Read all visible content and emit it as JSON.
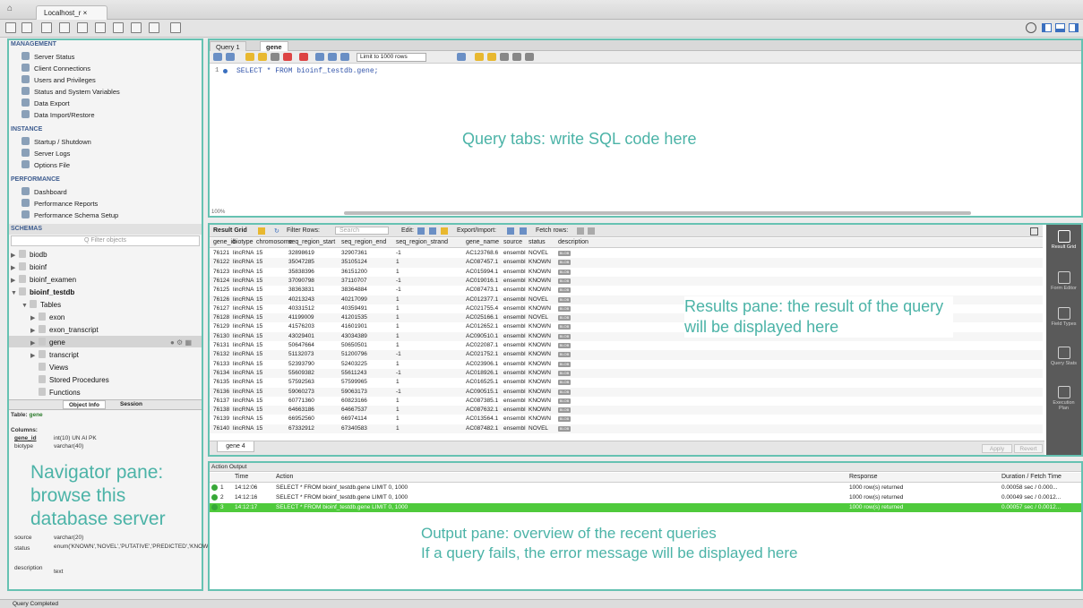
{
  "titlebar": {
    "connection_tab": "Localhost_r ×"
  },
  "navigator": {
    "management_title": "MANAGEMENT",
    "management": [
      "Server Status",
      "Client Connections",
      "Users and Privileges",
      "Status and System Variables",
      "Data Export",
      "Data Import/Restore"
    ],
    "instance_title": "INSTANCE",
    "instance": [
      "Startup / Shutdown",
      "Server Logs",
      "Options File"
    ],
    "performance_title": "PERFORMANCE",
    "performance": [
      "Dashboard",
      "Performance Reports",
      "Performance Schema Setup"
    ],
    "schemas_title": "SCHEMAS",
    "filter_placeholder": "Q Filter objects",
    "schemas": [
      "biodb",
      "bioinf",
      "bioinf_examen",
      "bioinf_testdb"
    ],
    "tables_label": "Tables",
    "tables": [
      "exon",
      "exon_transcript",
      "gene",
      "transcript"
    ],
    "views": "Views",
    "stored_procedures": "Stored Procedures",
    "functions": "Functions",
    "info_tabs": [
      "Object Info",
      "Session"
    ],
    "table_label": "Table:",
    "table_name": "gene",
    "columns_label": "Columns:",
    "columns": [
      {
        "name": "gene_id",
        "type": "int(10) UN AI PK"
      },
      {
        "name": "biotype",
        "type": "varchar(40)"
      },
      {
        "name": "source",
        "type": "varchar(20)"
      },
      {
        "name": "status",
        "type": "enum('KNOWN','NOVEL','PUTATIVE','PREDICTED','KNOWN_BY_PROJECTION','UNKNOWN')"
      },
      {
        "name": "description",
        "type": "text"
      }
    ]
  },
  "query": {
    "tabs": [
      "Query 1",
      "gene"
    ],
    "limit": "Limit to 1000 rows",
    "line": "1",
    "sql": "SELECT * FROM bioinf_testdb.gene;",
    "zoom": "100%"
  },
  "results": {
    "toolbar": {
      "grid": "Result Grid",
      "filter": "Filter Rows:",
      "search": "Search",
      "edit": "Edit:",
      "export": "Export/Import:",
      "fetch": "Fetch rows:"
    },
    "columns": [
      "gene_id",
      "biotype",
      "chromosome",
      "seq_region_start",
      "seq_region_end",
      "seq_region_strand",
      "gene_name",
      "source",
      "status",
      "description"
    ],
    "rows": [
      [
        "76121",
        "lincRNA",
        "15",
        "32898619",
        "32907361",
        "-1",
        "AC123768.6",
        "ensembl",
        "NOVEL"
      ],
      [
        "76122",
        "lincRNA",
        "15",
        "35047285",
        "35105124",
        "1",
        "AC087457.1",
        "ensembl",
        "KNOWN"
      ],
      [
        "76123",
        "lincRNA",
        "15",
        "35838396",
        "36151200",
        "1",
        "AC015994.1",
        "ensembl",
        "KNOWN"
      ],
      [
        "76124",
        "lincRNA",
        "15",
        "37090798",
        "37110707",
        "-1",
        "AC019016.1",
        "ensembl",
        "KNOWN"
      ],
      [
        "76125",
        "lincRNA",
        "15",
        "38363831",
        "38364884",
        "-1",
        "AC087473.1",
        "ensembl",
        "KNOWN"
      ],
      [
        "76126",
        "lincRNA",
        "15",
        "40213243",
        "40217099",
        "1",
        "AC012377.1",
        "ensembl",
        "NOVEL"
      ],
      [
        "76127",
        "lincRNA",
        "15",
        "40331512",
        "40359491",
        "1",
        "AC021755.4",
        "ensembl",
        "KNOWN"
      ],
      [
        "76128",
        "lincRNA",
        "15",
        "41199009",
        "41201535",
        "1",
        "AC025166.1",
        "ensembl",
        "NOVEL"
      ],
      [
        "76129",
        "lincRNA",
        "15",
        "41576203",
        "41601901",
        "1",
        "AC012652.1",
        "ensembl",
        "KNOWN"
      ],
      [
        "76130",
        "lincRNA",
        "15",
        "43029401",
        "43034389",
        "1",
        "AC090510.1",
        "ensembl",
        "KNOWN"
      ],
      [
        "76131",
        "lincRNA",
        "15",
        "50647664",
        "50650501",
        "1",
        "AC022087.1",
        "ensembl",
        "KNOWN"
      ],
      [
        "76132",
        "lincRNA",
        "15",
        "51132073",
        "51200796",
        "-1",
        "AC021752.1",
        "ensembl",
        "KNOWN"
      ],
      [
        "76133",
        "lincRNA",
        "15",
        "52393790",
        "52403225",
        "1",
        "AC023906.1",
        "ensembl",
        "KNOWN"
      ],
      [
        "76134",
        "lincRNA",
        "15",
        "55609382",
        "55611243",
        "-1",
        "AC018926.1",
        "ensembl",
        "KNOWN"
      ],
      [
        "76135",
        "lincRNA",
        "15",
        "57592563",
        "57599965",
        "1",
        "AC016525.1",
        "ensembl",
        "KNOWN"
      ],
      [
        "76136",
        "lincRNA",
        "15",
        "59060273",
        "59063173",
        "-1",
        "AC090515.1",
        "ensembl",
        "KNOWN"
      ],
      [
        "76137",
        "lincRNA",
        "15",
        "60771360",
        "60823166",
        "1",
        "AC087385.1",
        "ensembl",
        "KNOWN"
      ],
      [
        "76138",
        "lincRNA",
        "15",
        "64663186",
        "64667537",
        "1",
        "AC087632.1",
        "ensembl",
        "KNOWN"
      ],
      [
        "76139",
        "lincRNA",
        "15",
        "66952560",
        "66974114",
        "1",
        "AC013564.1",
        "ensembl",
        "KNOWN"
      ],
      [
        "76140",
        "lincRNA",
        "15",
        "67332912",
        "67340583",
        "1",
        "AC087482.1",
        "ensembl",
        "NOVEL"
      ]
    ],
    "blob": "BLOB",
    "result_tab": "gene 4",
    "apply": "Apply",
    "revert": "Revert",
    "side": [
      "Result Grid",
      "Form Editor",
      "Field Types",
      "Query Stats",
      "Execution Plan"
    ]
  },
  "output": {
    "title": "Action Output",
    "columns": [
      "",
      "Time",
      "Action",
      "Response",
      "Duration / Fetch Time"
    ],
    "rows": [
      [
        "1",
        "14:12:06",
        "SELECT * FROM bioinf_testdb.gene LIMIT 0, 1000",
        "1000 row(s) returned",
        "0.00058 sec / 0.000..."
      ],
      [
        "2",
        "14:12:16",
        "SELECT * FROM bioinf_testdb.gene LIMIT 0, 1000",
        "1000 row(s) returned",
        "0.00049 sec / 0.0012..."
      ],
      [
        "3",
        "14:12:17",
        "SELECT * FROM bioinf_testdb.gene LIMIT 0, 1000",
        "1000 row(s) returned",
        "0.00057 sec / 0.0012..."
      ]
    ]
  },
  "annotations": {
    "query": "Query tabs: write SQL code here",
    "results": "Results pane: the result of the query will be displayed here",
    "navigator": "Navigator pane: browse this database server",
    "output_line1": "Output pane: overview of the recent queries",
    "output_line2": "If a query fails, the error message will be displayed here"
  },
  "status": "Query Completed",
  "colors": {
    "annotation": "#4bb3a7",
    "selected_row": "#4fca3c",
    "accent": "#3d5c8f"
  }
}
